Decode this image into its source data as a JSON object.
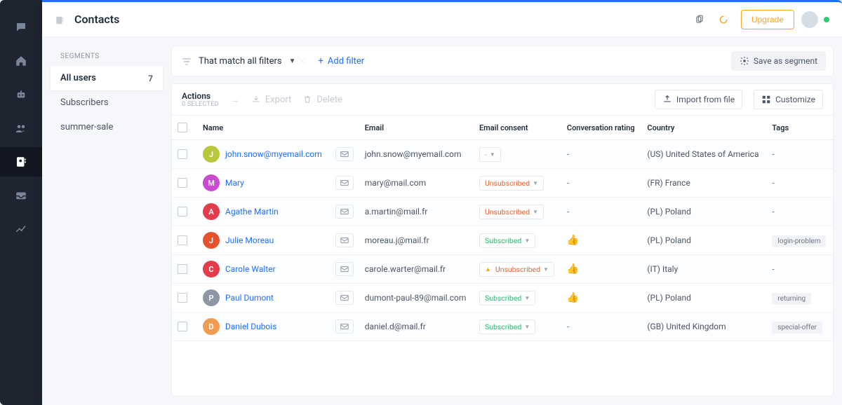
{
  "app": {
    "title": "Contacts"
  },
  "topbar": {
    "upgrade": "Upgrade"
  },
  "rail": [
    {
      "name": "chat-icon"
    },
    {
      "name": "home-icon"
    },
    {
      "name": "bot-icon"
    },
    {
      "name": "people-icon"
    },
    {
      "name": "contacts-icon",
      "active": true
    },
    {
      "name": "inbox-icon"
    },
    {
      "name": "trend-icon"
    }
  ],
  "segments": {
    "header": "SEGMENTS",
    "items": [
      {
        "label": "All users",
        "count": "7",
        "active": true
      },
      {
        "label": "Subscribers"
      },
      {
        "label": "summer-sale"
      }
    ]
  },
  "filters": {
    "match_label": "That match all filters",
    "add_filter": "Add filter",
    "save_segment": "Save as segment"
  },
  "actions": {
    "title": "Actions",
    "subtitle": "0 SELECTED",
    "export": "Export",
    "delete": "Delete",
    "import": "Import from file",
    "customize": "Customize"
  },
  "columns": {
    "name": "Name",
    "email": "Email",
    "consent": "Email consent",
    "rating": "Conversation rating",
    "country": "Country",
    "tags": "Tags"
  },
  "consent_labels": {
    "subscribed": "Subscribed",
    "unsubscribed": "Unsubscribed",
    "empty": "-"
  },
  "rows": [
    {
      "initial": "J",
      "color": "#b7c93a",
      "name": "john.snow@myemail.com",
      "email": "john.snow@myemail.com",
      "consent": "empty",
      "rating": "-",
      "country": "(US) United States of America",
      "tag": "-"
    },
    {
      "initial": "M",
      "color": "#c94bd1",
      "name": "Mary",
      "email": "mary@mail.com",
      "consent": "unsub",
      "rating": "-",
      "country": "(FR) France",
      "tag": "-"
    },
    {
      "initial": "A",
      "color": "#e23d4b",
      "name": "Agathe Martin",
      "email": "a.martin@mail.fr",
      "consent": "unsub",
      "rating": "-",
      "country": "(PL) Poland",
      "tag": "-"
    },
    {
      "initial": "J",
      "color": "#e6522e",
      "name": "Julie Moreau",
      "email": "moreau.j@mail.fr",
      "consent": "sub",
      "rating": "up",
      "country": "(PL) Poland",
      "tag": "login-problem"
    },
    {
      "initial": "C",
      "color": "#e23d4b",
      "name": "Carole Walter",
      "email": "carole.warter@mail.fr",
      "consent": "unsub-warn",
      "rating": "up",
      "country": "(IT) Italy",
      "tag": "-"
    },
    {
      "initial": "P",
      "color": "#8d97a3",
      "name": "Paul Dumont",
      "email": "dumont-paul-89@mail.com",
      "consent": "sub",
      "rating": "up",
      "country": "(PL) Poland",
      "tag": "returning"
    },
    {
      "initial": "D",
      "color": "#f29b52",
      "name": "Daniel Dubois",
      "email": "daniel.d@mail.fr",
      "consent": "sub",
      "rating": "-",
      "country": "(GB) United Kingdom",
      "tag": "special-offer"
    }
  ]
}
